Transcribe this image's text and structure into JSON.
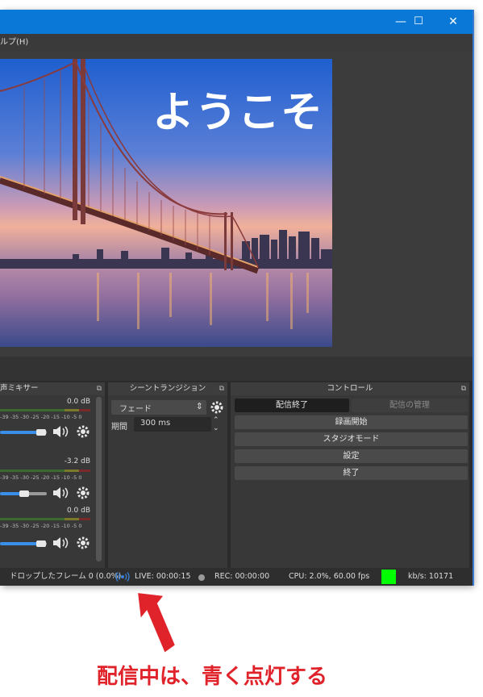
{
  "window": {
    "minimize_glyph": "—",
    "maximize_glyph": "☐",
    "close_glyph": "✕"
  },
  "menubar": {
    "help_label": "ルプ(H)"
  },
  "preview": {
    "welcome_text": "ようこそ"
  },
  "docks": {
    "mixer": {
      "title": "声ミキサー",
      "tick_labels": "-39 -35 -30 -25 -20 -15 -10 -5 0",
      "channels": [
        {
          "db": "0.0 dB",
          "volume_fraction": 0.92
        },
        {
          "db": "-3.2 dB",
          "volume_fraction": 0.55
        },
        {
          "db": "0.0 dB",
          "volume_fraction": 0.92
        }
      ]
    },
    "transitions": {
      "title": "シーントランジション",
      "transition_value": "フェード",
      "duration_label": "期間",
      "duration_value": "300 ms"
    },
    "controls": {
      "title": "コントロール",
      "stop_streaming": "配信終了",
      "manage_broadcast": "配信の管理",
      "start_recording": "録画開始",
      "studio_mode": "スタジオモード",
      "settings": "設定",
      "exit": "終了"
    }
  },
  "status": {
    "dropped_frames": "ドロップしたフレーム 0 (0.0%)",
    "live": "LIVE: 00:00:15",
    "rec": "REC: 00:00:00",
    "cpu": "CPU: 2.0%, 60.00 fps",
    "kbps": "kb/s: 10171",
    "health_color": "#00ff00",
    "live_icon_color": "#3a7fd8"
  },
  "annotation": {
    "text": "配信中は、青く点灯する",
    "color": "#e0232a"
  }
}
